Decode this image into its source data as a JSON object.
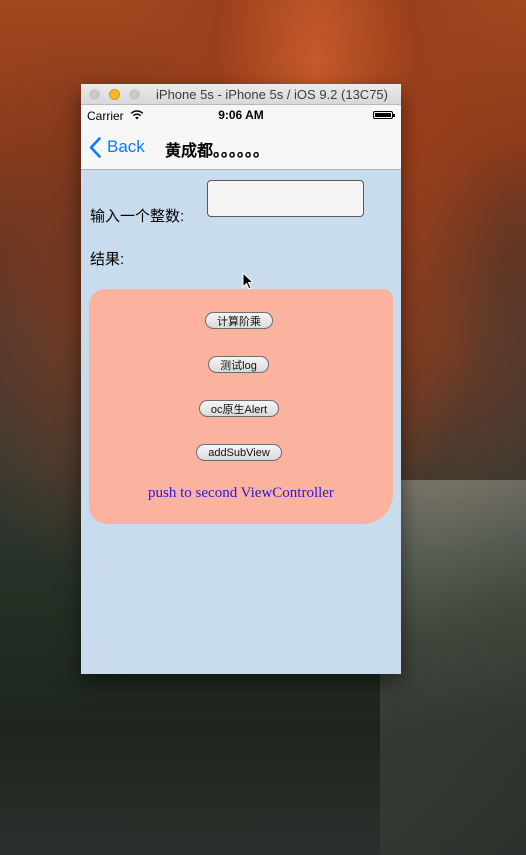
{
  "window": {
    "title": "iPhone 5s - iPhone 5s / iOS 9.2 (13C75)"
  },
  "status_bar": {
    "carrier": "Carrier",
    "time": "9:06 AM"
  },
  "nav": {
    "back_label": "Back",
    "title": "黄成都。。。。。。"
  },
  "form": {
    "input_label": "输入一个整数:",
    "input_value": "",
    "result_label": "结果:"
  },
  "panel": {
    "buttons": [
      "计算阶乘",
      "测试log",
      "oc原生Alert",
      "addSubView"
    ],
    "push_link": "push to second ViewController"
  },
  "colors": {
    "content_bg": "#c9dcee",
    "panel_bg": "#fbb3a0",
    "tint": "#0a7aff",
    "link": "#2a19d6"
  },
  "icons": [
    "wifi-icon",
    "battery-icon",
    "back-chevron-icon",
    "mouse-cursor-icon"
  ]
}
